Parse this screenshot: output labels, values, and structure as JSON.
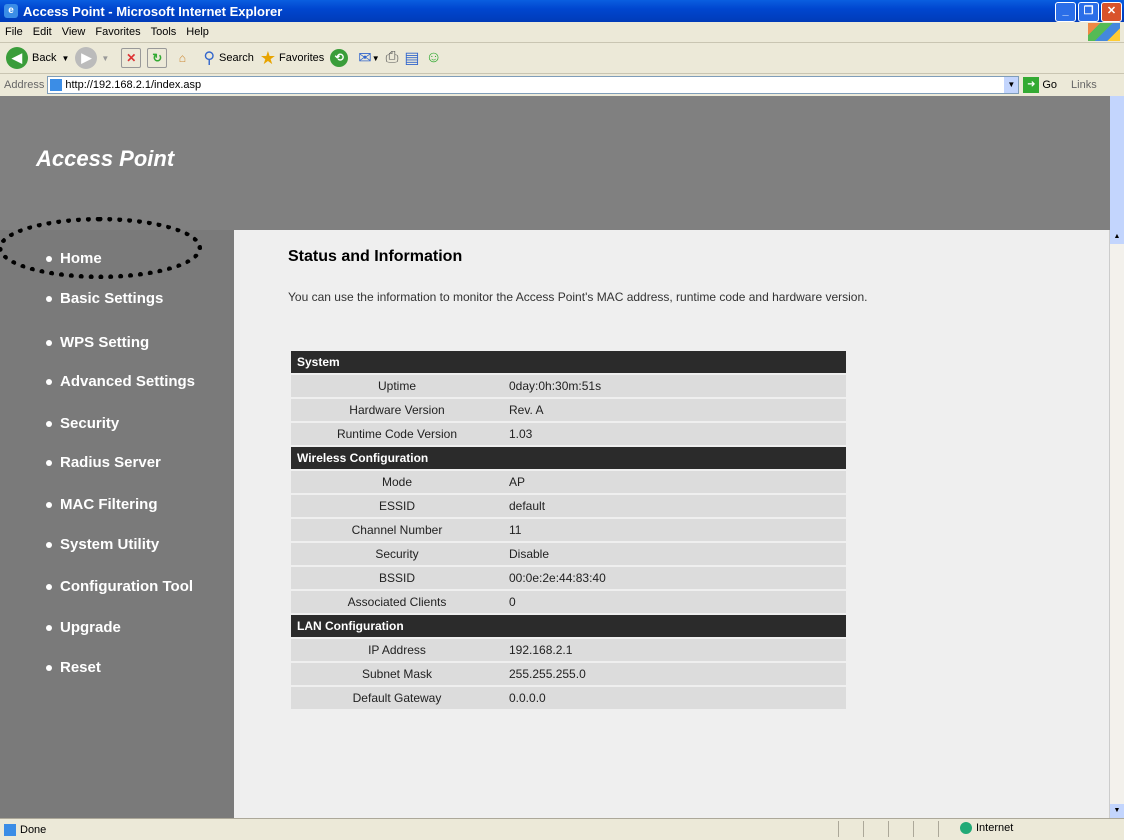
{
  "window": {
    "title": "Access Point - Microsoft Internet Explorer"
  },
  "menu": [
    "File",
    "Edit",
    "View",
    "Favorites",
    "Tools",
    "Help"
  ],
  "toolbar": {
    "back": "Back",
    "search": "Search",
    "favorites": "Favorites"
  },
  "address": {
    "label": "Address",
    "url": "http://192.168.2.1/index.asp",
    "go": "Go",
    "links": "Links"
  },
  "banner": {
    "title": "Access Point"
  },
  "nav": [
    "Home",
    "Basic Settings",
    "WPS Setting",
    "Advanced Settings",
    "Security",
    "Radius Server",
    "MAC Filtering",
    "System Utility",
    "Configuration Tool",
    "Upgrade",
    "Reset"
  ],
  "main": {
    "title": "Status and Information",
    "description": "You can use the information to monitor the Access Point's MAC address, runtime code and hardware version.",
    "sections": [
      {
        "name": "System",
        "rows": [
          {
            "key": "Uptime",
            "value": "0day:0h:30m:51s"
          },
          {
            "key": "Hardware Version",
            "value": "Rev. A"
          },
          {
            "key": "Runtime Code Version",
            "value": "1.03"
          }
        ]
      },
      {
        "name": "Wireless Configuration",
        "rows": [
          {
            "key": "Mode",
            "value": "AP"
          },
          {
            "key": "ESSID",
            "value": "default"
          },
          {
            "key": "Channel Number",
            "value": "11"
          },
          {
            "key": "Security",
            "value": "Disable"
          },
          {
            "key": "BSSID",
            "value": "00:0e:2e:44:83:40"
          },
          {
            "key": "Associated Clients",
            "value": "0"
          }
        ]
      },
      {
        "name": "LAN Configuration",
        "rows": [
          {
            "key": "IP Address",
            "value": "192.168.2.1"
          },
          {
            "key": "Subnet Mask",
            "value": "255.255.255.0"
          },
          {
            "key": "Default Gateway",
            "value": "0.0.0.0"
          }
        ]
      }
    ]
  },
  "status": {
    "left": "Done",
    "zone": "Internet"
  }
}
